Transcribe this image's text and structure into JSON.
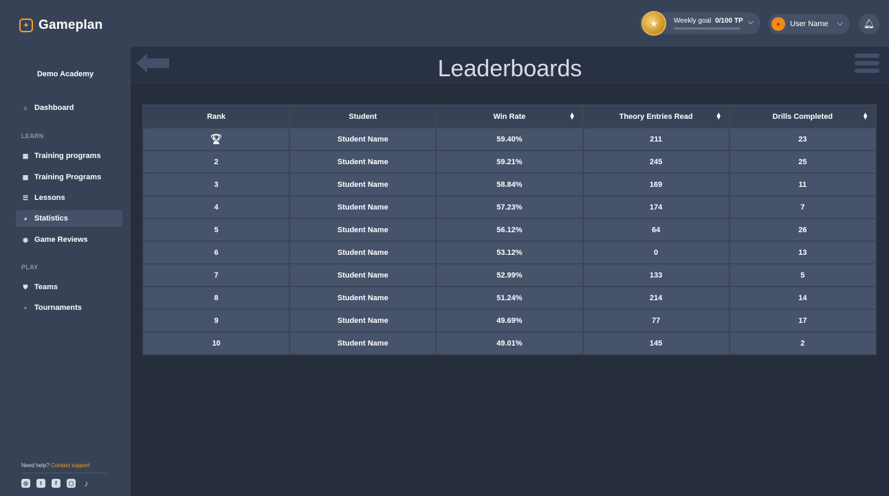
{
  "app": {
    "name": "Gameplan",
    "logo_icon": "controller-badge-icon"
  },
  "topbar": {
    "goal_label": "Weekly goal",
    "goal_value": "0/100 TP",
    "goal_progress": 0,
    "user_name": "User Name"
  },
  "sidebar": {
    "academy": "Demo Academy",
    "items": [
      {
        "label": "Dashboard",
        "icon": "dashboard-icon"
      },
      {
        "label": "Training programs",
        "icon": "calendar-icon"
      },
      {
        "label": "Training Programs",
        "icon": "calendar-icon"
      },
      {
        "label": "Lessons",
        "icon": "list-icon"
      },
      {
        "label": "Statistics",
        "icon": "pie-chart-icon",
        "active": true
      },
      {
        "label": "Game Reviews",
        "icon": "review-icon"
      },
      {
        "label": "Teams",
        "icon": "shield-icon"
      },
      {
        "label": "Tournaments",
        "icon": "trophy-icon"
      }
    ],
    "sections": [
      "LEARN",
      "PLAY"
    ],
    "help_prefix": "Need help?",
    "help_link": "Contact support",
    "socials": [
      "instagram-icon",
      "twitter-icon",
      "facebook-icon",
      "twitch-icon",
      "tiktok-icon"
    ]
  },
  "page": {
    "title": "Leaderboards"
  },
  "table": {
    "columns": [
      "Rank",
      "Student",
      "Win Rate",
      "Theory Entries Read",
      "Drills Completed"
    ],
    "rows": [
      {
        "rank": "",
        "student": "Student Name",
        "win_rate": "59.40%",
        "theory": "211",
        "drills": "23"
      },
      {
        "rank": "2",
        "student": "Student Name",
        "win_rate": "59.21%",
        "theory": "245",
        "drills": "25"
      },
      {
        "rank": "3",
        "student": "Student Name",
        "win_rate": "58.84%",
        "theory": "169",
        "drills": "11"
      },
      {
        "rank": "4",
        "student": "Student Name",
        "win_rate": "57.23%",
        "theory": "174",
        "drills": "7"
      },
      {
        "rank": "5",
        "student": "Student Name",
        "win_rate": "56.12%",
        "theory": "64",
        "drills": "26"
      },
      {
        "rank": "6",
        "student": "Student Name",
        "win_rate": "53.12%",
        "theory": "0",
        "drills": "13"
      },
      {
        "rank": "7",
        "student": "Student Name",
        "win_rate": "52.99%",
        "theory": "133",
        "drills": "5"
      },
      {
        "rank": "8",
        "student": "Student Name",
        "win_rate": "51.24%",
        "theory": "214",
        "drills": "14"
      },
      {
        "rank": "9",
        "student": "Student Name",
        "win_rate": "49.69%",
        "theory": "77",
        "drills": "17"
      },
      {
        "rank": "10",
        "student": "Student Name",
        "win_rate": "49.01%",
        "theory": "145",
        "drills": "2"
      }
    ]
  },
  "colors": {
    "accent": "#f0a12b",
    "sidebar": "#374256",
    "background": "#262e3d",
    "row": "#46536b"
  }
}
